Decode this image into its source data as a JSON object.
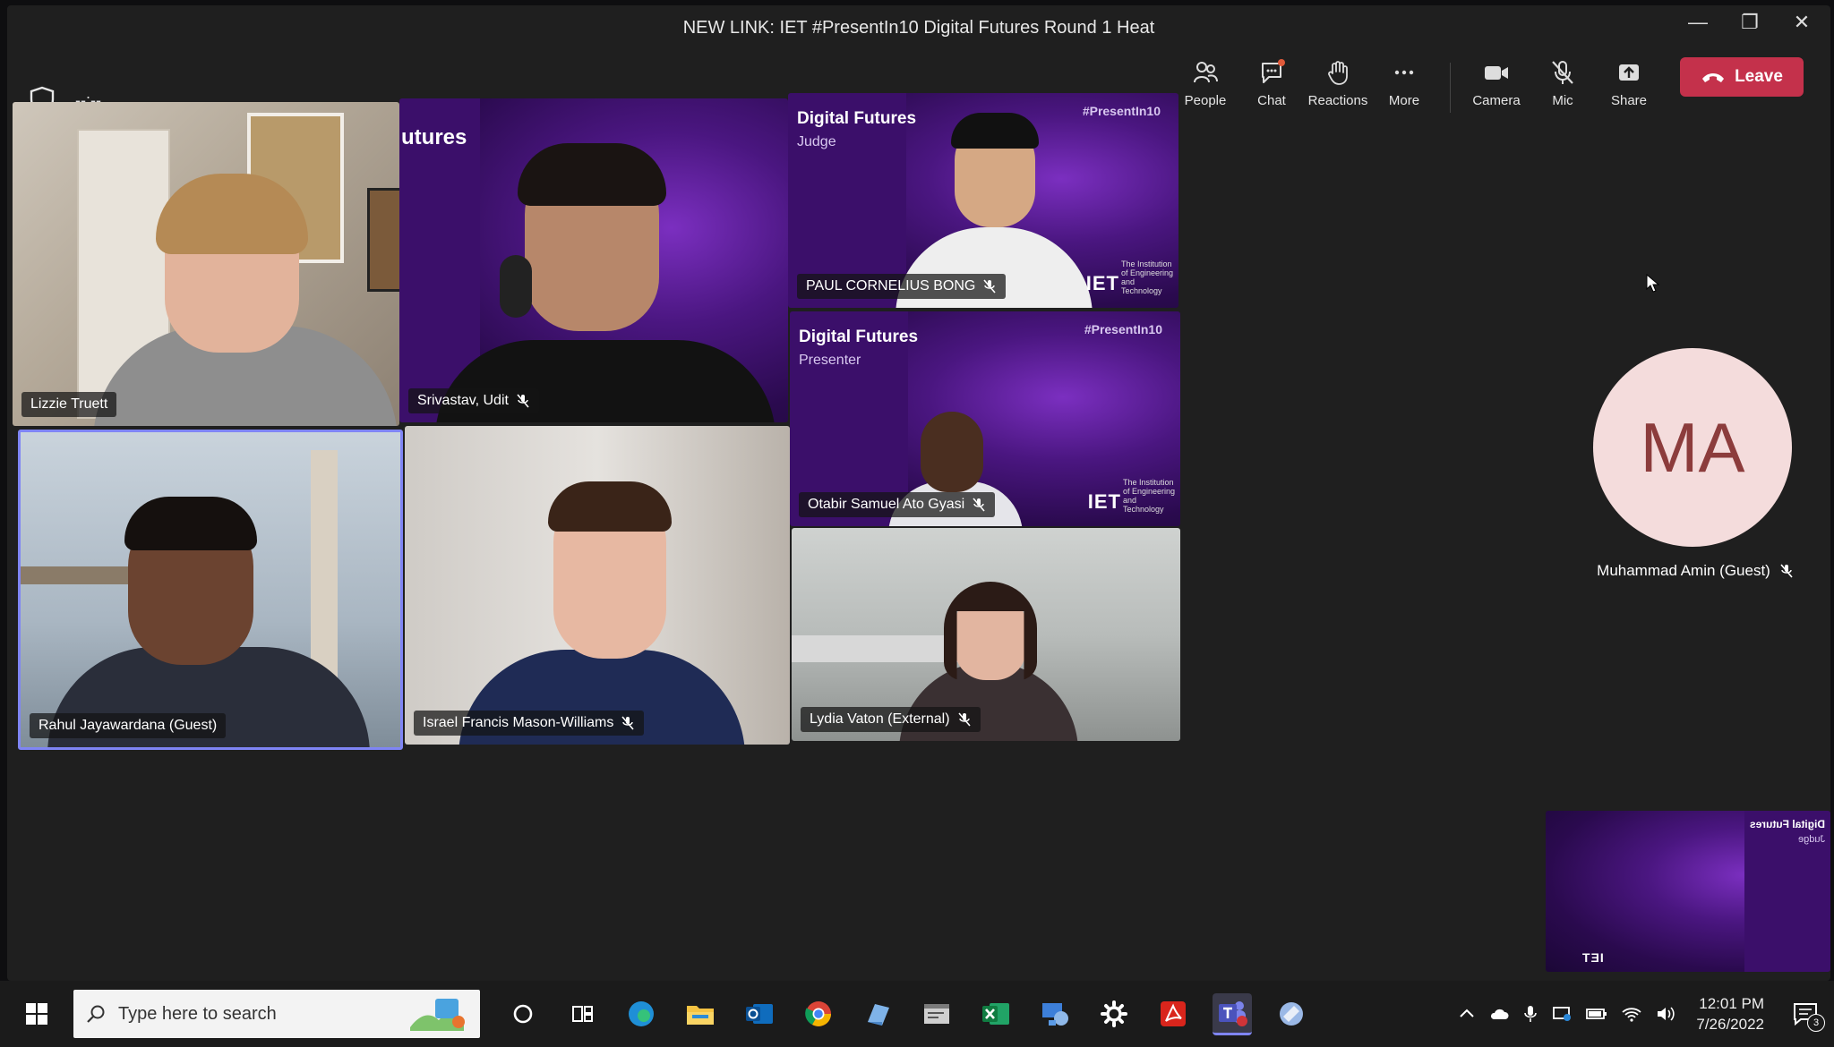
{
  "window": {
    "title": "NEW LINK: IET #PresentIn10 Digital Futures Round 1 Heat",
    "timer": "--:--"
  },
  "toolbar": {
    "people": "People",
    "chat": "Chat",
    "reactions": "Reactions",
    "more": "More",
    "camera": "Camera",
    "mic": "Mic",
    "share": "Share",
    "leave": "Leave"
  },
  "participants": {
    "lizzie": "Lizzie Truett",
    "udit": "Srivastav, Udit",
    "paul": "PAUL CORNELIUS BONG",
    "otabir": "Otabir Samuel Ato Gyasi",
    "rahul": "Rahul Jayawardana (Guest)",
    "israel": "Israel Francis Mason-Williams",
    "lydia": "Lydia Vaton (External)",
    "muhammad": "Muhammad Amin (Guest)",
    "muhammad_initials": "MA"
  },
  "branding": {
    "futures_partial": "utures",
    "digital_futures": "Digital Futures",
    "judge": "Judge",
    "presenter": "Presenter",
    "hashtag": "#PresentIn10",
    "iet": "IET",
    "iet_sub": "The Institution of Engineering and Technology",
    "mirror_title": "Digital Futures",
    "mirror_role": "Judge"
  },
  "taskbar": {
    "search_placeholder": "Type here to search",
    "time": "12:01 PM",
    "date": "7/26/2022",
    "notification_count": "3"
  }
}
